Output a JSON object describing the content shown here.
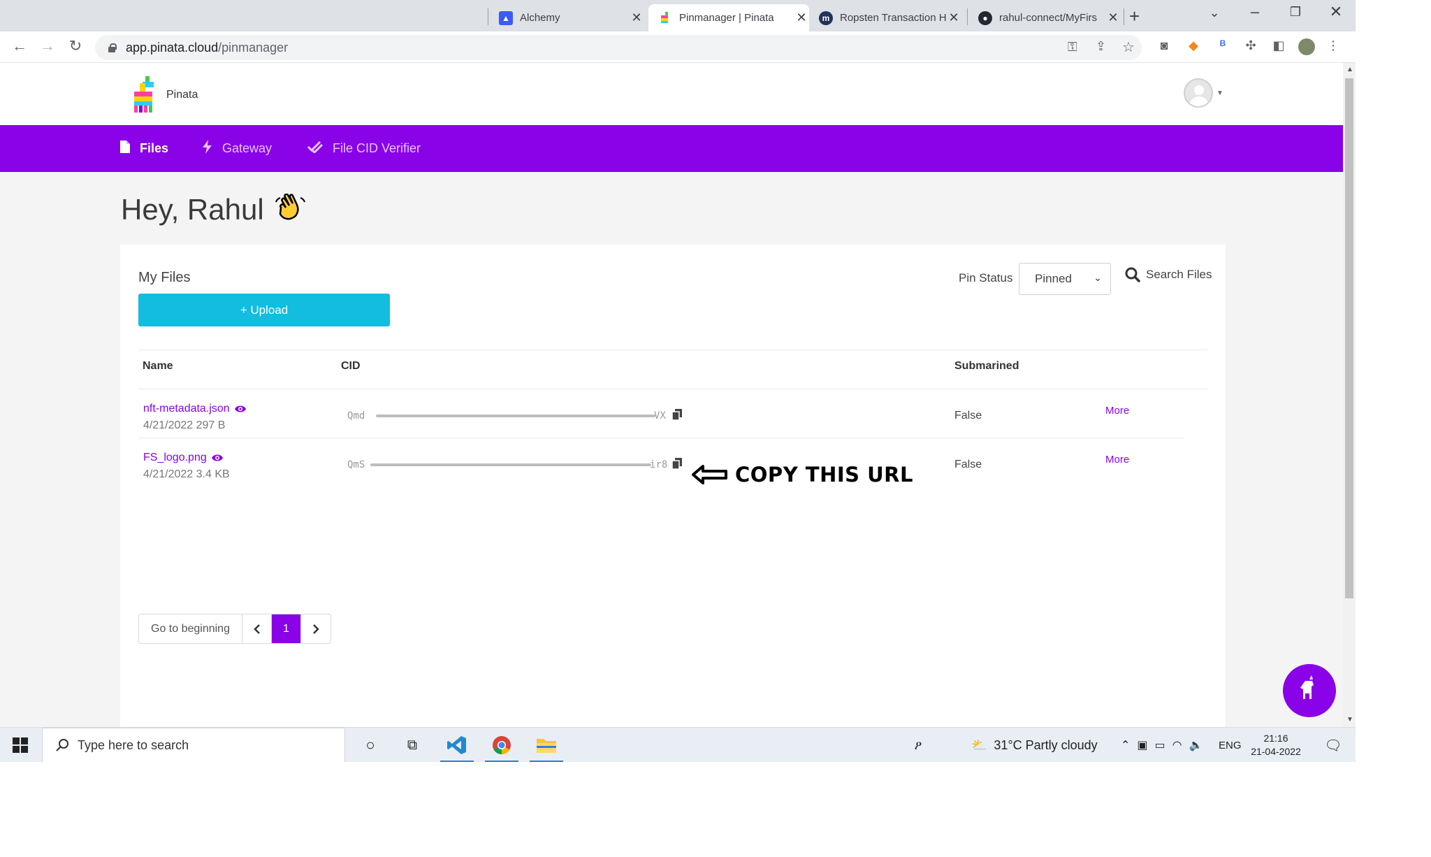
{
  "browser": {
    "tabs": [
      {
        "title": "Alchemy",
        "active": false
      },
      {
        "title": "Pinmanager | Pinata",
        "active": true
      },
      {
        "title": "Ropsten Transaction H",
        "active": false
      },
      {
        "title": "rahul-connect/MyFirs",
        "active": false
      }
    ],
    "url_host": "app.pinata.cloud",
    "url_path": "/pinmanager"
  },
  "site": {
    "brand": "Pinata",
    "nav": [
      {
        "label": "Files",
        "icon": "file-icon",
        "active": true
      },
      {
        "label": "Gateway",
        "icon": "bolt-icon",
        "active": false
      },
      {
        "label": "File CID Verifier",
        "icon": "check-double-icon",
        "active": false
      }
    ],
    "greeting": "Hey, Rahul",
    "accent": "#8a02e8",
    "upload_color": "#12bde0"
  },
  "files": {
    "title": "My Files",
    "upload_label": "+ Upload",
    "pin_status_label": "Pin Status",
    "pin_status_value": "Pinned",
    "search_label": "Search Files",
    "columns": [
      "Name",
      "CID",
      "Submarined"
    ],
    "rows": [
      {
        "name": "nft-metadata.json",
        "meta": "4/21/2022 297 B",
        "cid_start": "Qmd",
        "cid_end": "VX",
        "submarined": "False",
        "more": "More"
      },
      {
        "name": "FS_logo.png",
        "meta": "4/21/2022 3.4 KB",
        "cid_start": "QmS",
        "cid_end": "ir8",
        "submarined": "False",
        "more": "More"
      }
    ],
    "annotation": "COPY THIS URL",
    "pager": {
      "first": "Go to beginning",
      "current": "1"
    }
  },
  "taskbar": {
    "search_placeholder": "Type here to search",
    "weather": "31°C  Partly cloudy",
    "lang": "ENG",
    "time": "21:16",
    "date": "21-04-2022"
  }
}
